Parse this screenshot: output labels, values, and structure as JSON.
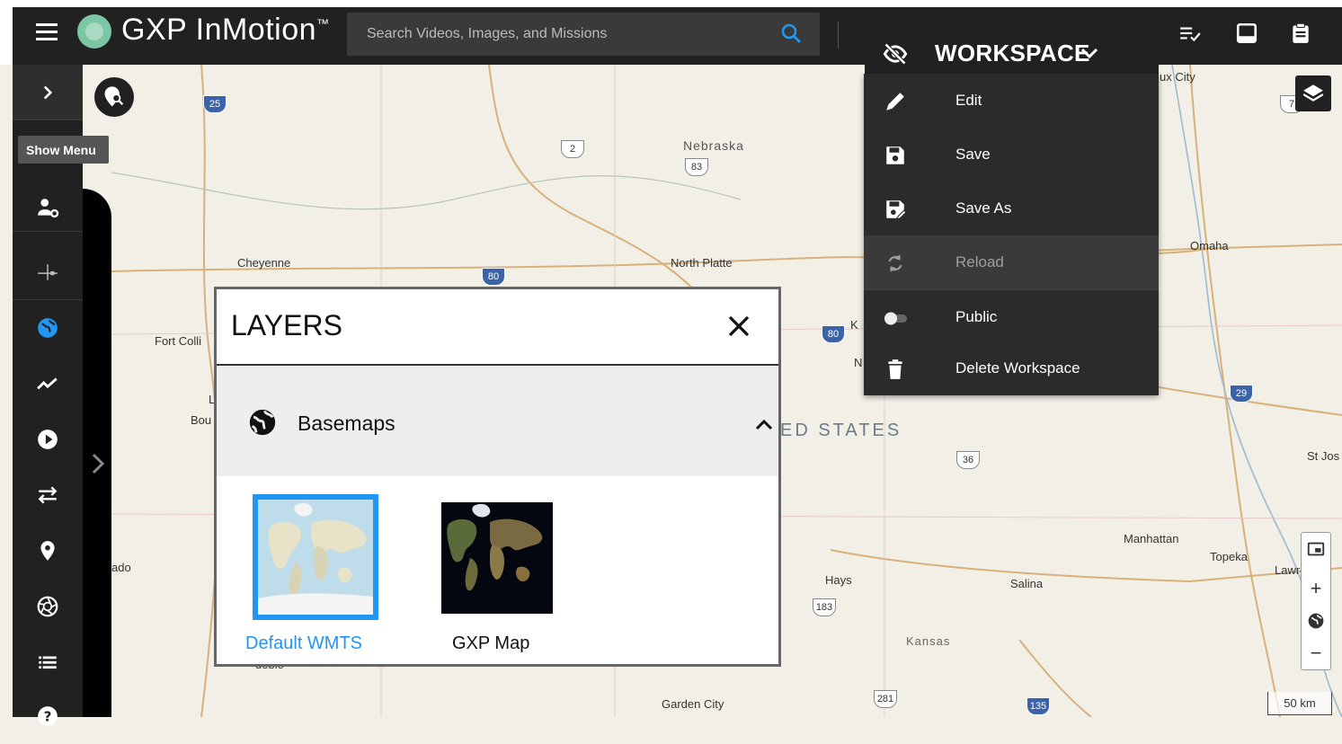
{
  "app": {
    "brand": "GXP InMotion",
    "trademark": "™",
    "search_placeholder": "Search Videos, Images, and Missions"
  },
  "sidebar": {
    "tooltip": "Show Menu"
  },
  "workspace": {
    "label": "WORKSPACE",
    "menu": [
      {
        "label": "Edit",
        "icon": "pencil-icon"
      },
      {
        "label": "Save",
        "icon": "floppy-icon"
      },
      {
        "label": "Save As",
        "icon": "save-as-icon"
      },
      {
        "label": "Reload",
        "icon": "reload-icon"
      },
      {
        "label": "Public",
        "icon": "toggle-icon"
      },
      {
        "label": "Delete Workspace",
        "icon": "trash-icon"
      }
    ]
  },
  "layers_panel": {
    "title": "LAYERS",
    "section": "Basemaps",
    "basemaps": [
      {
        "label": "Default WMTS",
        "selected": true
      },
      {
        "label": "GXP Map",
        "selected": false
      }
    ]
  },
  "map": {
    "labels": [
      {
        "text": "Nebraska"
      },
      {
        "text": "Cheyenne"
      },
      {
        "text": "North Platte"
      },
      {
        "text": "Fort Colli"
      },
      {
        "text": "L"
      },
      {
        "text": "Bou"
      },
      {
        "text": "ado"
      },
      {
        "text": "K"
      },
      {
        "text": "N"
      },
      {
        "text": "Omaha"
      },
      {
        "text": "ux City"
      },
      {
        "text": "Manhattan"
      },
      {
        "text": "Topeka"
      },
      {
        "text": "Lawrence"
      },
      {
        "text": "Salina"
      },
      {
        "text": "Hays"
      },
      {
        "text": "Kansas"
      },
      {
        "text": "Garden City"
      },
      {
        "text": "St Jos"
      },
      {
        "text": "ueblo"
      }
    ],
    "state_text": "ED STATES",
    "shields": [
      {
        "text": "25"
      },
      {
        "text": "2"
      },
      {
        "text": "83"
      },
      {
        "text": "80"
      },
      {
        "text": "80"
      },
      {
        "text": "7"
      },
      {
        "text": "29"
      },
      {
        "text": "36"
      },
      {
        "text": "183"
      },
      {
        "text": "281"
      },
      {
        "text": "135"
      }
    ],
    "scale": "50 km",
    "zoom_in": "+",
    "zoom_out": "−"
  },
  "colors": {
    "toolbar": "#212121",
    "accent_blue": "#2196f3",
    "map_bg": "#f2efe6"
  }
}
